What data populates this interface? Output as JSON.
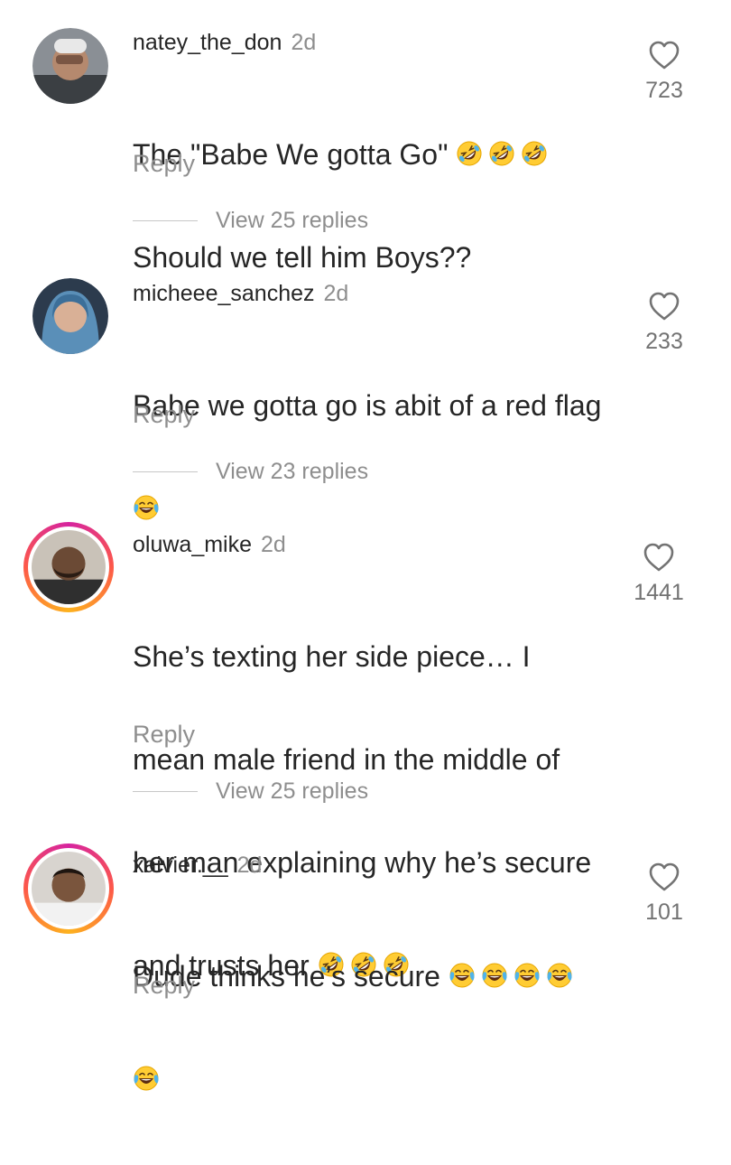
{
  "comments": [
    {
      "username": "natey_the_don",
      "time": "2d",
      "lines": [
        "The \"Babe We gotta Go\" ",
        "Should we tell him Boys??"
      ],
      "reply_label": "Reply",
      "view_replies": "View 25 replies",
      "likes": "723",
      "avatar_icon": "person-photo-icon"
    },
    {
      "username": "micheee_sanchez",
      "time": "2d",
      "lines": [
        "Babe we gotta go is abit of a red flag",
        ""
      ],
      "reply_label": "Reply",
      "view_replies": "View 23 replies",
      "likes": "233",
      "avatar_icon": "person-photo-icon"
    },
    {
      "username": "oluwa_mike",
      "time": "2d",
      "lines": [
        "She’s texting her side piece… I",
        "mean male friend in the middle of",
        "her man explaining why he’s secure",
        "and trusts her "
      ],
      "reply_label": "Reply",
      "view_replies": "View 25 replies",
      "likes": "1441",
      "avatar_icon": "person-photo-icon"
    },
    {
      "username": "xaivier.__",
      "time": "2d",
      "lines": [
        "Dude thinks he’s secure ",
        ""
      ],
      "reply_label": "Reply",
      "likes": "101",
      "avatar_icon": "person-photo-icon"
    }
  ],
  "icons": {
    "like": "heart-outline-icon",
    "rofl": "rolling-on-floor-laughing-emoji",
    "joy": "tears-of-joy-emoji"
  },
  "colors": {
    "text": "#262626",
    "muted": "#8e8e8e",
    "story_ring": "#d6249f"
  }
}
